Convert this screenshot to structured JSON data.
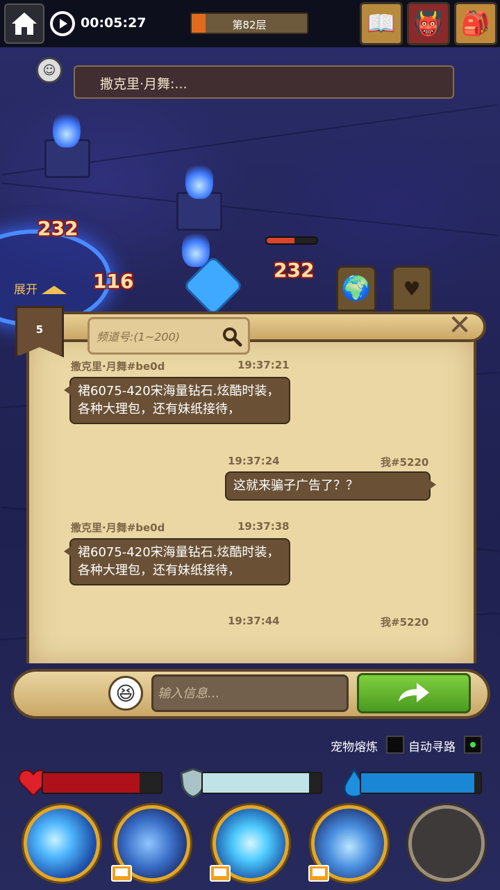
{
  "topbar": {
    "timer": "00:05:27",
    "floor_label": "第82层",
    "floor_progress": 0.12,
    "icons": [
      "spellbook-icon",
      "monster-face-icon",
      "backpack-icon"
    ]
  },
  "announcement": {
    "text": "撒克里·月舞:..."
  },
  "combat": {
    "damage_numbers": [
      "232",
      "116",
      "232"
    ],
    "expand_label": "展开",
    "enemy_hp": 0.55
  },
  "chat": {
    "channel_number": "5",
    "search_placeholder": "频道号:(1~200)",
    "messages": [
      {
        "sender": "撒克里·月舞#be0d",
        "time": "19:37:21",
        "text": "裙6075-420宋海量钻石.炫酷时装，各种大理包，还有妹纸接待，",
        "side": "left"
      },
      {
        "sender": "我#5220",
        "time": "19:37:24",
        "text": "这就来骗子广告了？？",
        "side": "right"
      },
      {
        "sender": "撒克里·月舞#be0d",
        "time": "19:37:38",
        "text": "裙6075-420宋海量钻石.炫酷时装，各种大理包，还有妹纸接待，",
        "side": "left"
      },
      {
        "sender": "我#5220",
        "time": "19:37:44",
        "text": "",
        "side": "right"
      }
    ],
    "input_placeholder": "输入信息..."
  },
  "toggles": {
    "pet_smelt_label": "宠物熔炼",
    "pet_smelt_on": false,
    "auto_path_label": "自动寻路",
    "auto_path_on": true
  },
  "stats": {
    "hp": 0.82,
    "shield": 0.9,
    "mana": 0.95,
    "colors": {
      "hp": "#b0101a",
      "shield": "#bfe3e6",
      "mana": "#1a86d6"
    }
  },
  "skills": [
    {
      "name": "ice-shard-skill",
      "ad": false
    },
    {
      "name": "lightning-skill",
      "ad": true
    },
    {
      "name": "frost-nova-skill",
      "ad": true
    },
    {
      "name": "vortex-skill",
      "ad": true
    },
    {
      "name": "summon-skill",
      "ad": false
    }
  ]
}
